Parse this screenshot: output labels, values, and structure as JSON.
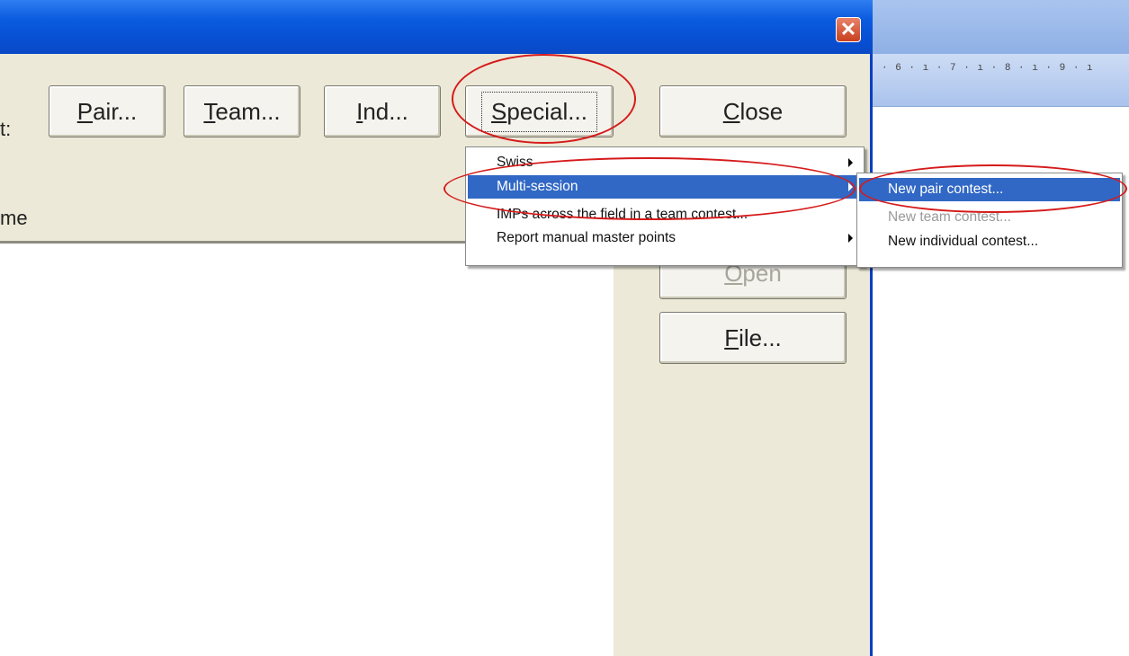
{
  "document": {
    "ruler_ticks": "· 6 · ı · 7 · ı · 8 · ı · 9 · ı"
  },
  "dialog": {
    "close_glyph": "✕",
    "label_left": "t:",
    "label_name": "me",
    "buttons": {
      "pair": {
        "u": "P",
        "rest": "air..."
      },
      "team": {
        "u": "T",
        "rest": "eam..."
      },
      "ind": {
        "u": "I",
        "rest": "nd..."
      },
      "special": {
        "u": "S",
        "rest": "pecial..."
      },
      "close": {
        "u": "C",
        "rest": "lose"
      },
      "open": {
        "pre": "",
        "u": "O",
        "rest": "pen"
      },
      "file": {
        "u": "F",
        "rest": "ile..."
      }
    }
  },
  "special_menu": {
    "items": [
      {
        "label": "Swiss",
        "has_submenu": true
      },
      {
        "label": "Multi-session",
        "has_submenu": true,
        "selected": true
      },
      {
        "label": "IMPs across the field in a team contest...",
        "has_submenu": false
      },
      {
        "label": "Report manual master points",
        "has_submenu": true
      }
    ]
  },
  "multisession_submenu": {
    "items": [
      {
        "label": "New pair contest...",
        "selected": true
      },
      {
        "label": "New team contest...",
        "disabled": true
      },
      {
        "label": "New individual contest..."
      }
    ]
  },
  "colors": {
    "menu_highlight": "#3168c5",
    "annotation_red": "#d61a1a",
    "dialog_face": "#ece9d8"
  }
}
